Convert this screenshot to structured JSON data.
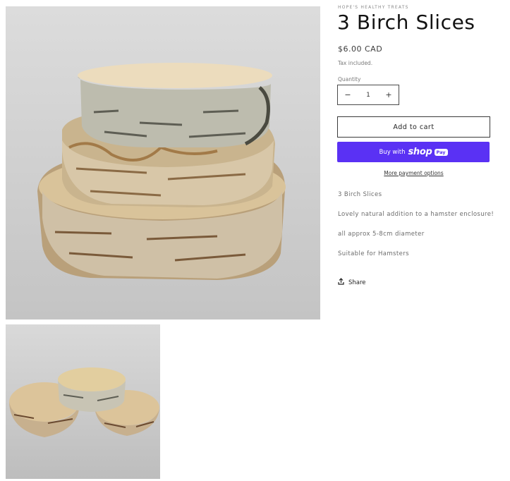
{
  "product": {
    "vendor": "HOPE'S HEALTHY TREATS",
    "title": "3 Birch Slices",
    "price": "$6.00 CAD",
    "tax_note": "Tax included.",
    "quantity_label": "Quantity",
    "quantity_value": "1",
    "decrement_symbol": "−",
    "increment_symbol": "+",
    "add_to_cart_label": "Add to cart",
    "buy_with_label": "Buy with",
    "shop_label": "shop",
    "pay_label": "Pay",
    "more_payment_label": "More payment options",
    "description": [
      "3 Birch Slices",
      "Lovely natural addition to a hamster enclosure!",
      "all approx 5-8cm diameter",
      "Suitable for Hamsters"
    ],
    "share_label": "Share",
    "share_icon": "share-upload-icon"
  },
  "media": {
    "main_image": "birch-slices-stacked-photo",
    "thumb_image": "birch-slices-spread-photo"
  },
  "colors": {
    "buy_button": "#5a31f4",
    "text": "#121212",
    "muted_text": "#6b6b6b"
  }
}
